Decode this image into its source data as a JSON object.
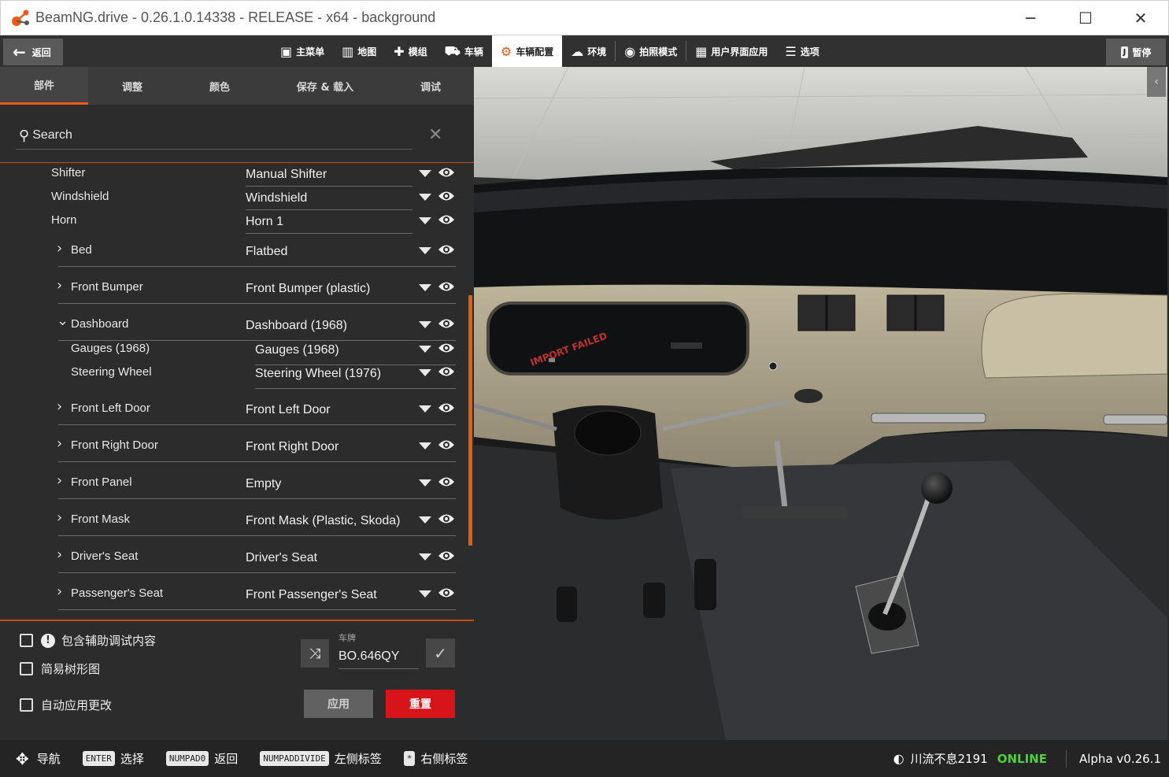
{
  "window": {
    "title": "BeamNG.drive - 0.26.1.0.14338 - RELEASE - x64 - background",
    "minimize": "─",
    "maximize": "☐",
    "close": "✕"
  },
  "menubar": {
    "back_label": "返回",
    "items": [
      {
        "label": "主菜单",
        "icon": "grid-icon"
      },
      {
        "label": "地图",
        "icon": "map-icon"
      },
      {
        "label": "模组",
        "icon": "puzzle-icon"
      },
      {
        "label": "车辆",
        "icon": "car-icon"
      },
      {
        "label": "车辆配置",
        "icon": "engine-icon",
        "active": true
      },
      {
        "label": "环境",
        "icon": "weather-icon"
      },
      {
        "label": "拍照模式",
        "icon": "camera-icon"
      },
      {
        "label": "用户界面应用",
        "icon": "apps-icon"
      },
      {
        "label": "选项",
        "icon": "sliders-icon"
      }
    ],
    "pause_label": "暂停",
    "pause_key": "J"
  },
  "tabs": [
    "部件",
    "调整",
    "颜色",
    "保存 & 载入",
    "调试"
  ],
  "search": {
    "placeholder": "Search"
  },
  "parts": [
    {
      "name": "Shifter",
      "value": "Manual Shifter",
      "indent": 0,
      "expandable": false
    },
    {
      "name": "Windshield",
      "value": "Windshield",
      "indent": 0,
      "expandable": false
    },
    {
      "name": "Horn",
      "value": "Horn 1",
      "indent": 0,
      "expandable": false
    },
    {
      "name": "Bed",
      "value": "Flatbed",
      "indent": 1,
      "expandable": true
    },
    {
      "name": "Front Bumper",
      "value": "Front Bumper (plastic)",
      "indent": 1,
      "expandable": true
    },
    {
      "name": "Dashboard",
      "value": "Dashboard (1968)",
      "indent": 1,
      "expandable": true,
      "expanded": true
    },
    {
      "name": "Gauges (1968)",
      "value": "Gauges (1968)",
      "indent": 2,
      "expandable": false
    },
    {
      "name": "Steering Wheel",
      "value": "Steering Wheel (1976)",
      "indent": 2,
      "expandable": false
    },
    {
      "name": "Front Left Door",
      "value": "Front Left Door",
      "indent": 1,
      "expandable": true
    },
    {
      "name": "Front Right Door",
      "value": "Front Right Door",
      "indent": 1,
      "expandable": true
    },
    {
      "name": "Front Panel",
      "value": "Empty",
      "indent": 1,
      "expandable": true
    },
    {
      "name": "Front Mask",
      "value": "Front Mask (Plastic, Skoda)",
      "indent": 1,
      "expandable": true
    },
    {
      "name": "Driver's Seat",
      "value": "Driver's Seat",
      "indent": 1,
      "expandable": true
    },
    {
      "name": "Passenger's Seat",
      "value": "Front Passenger's Seat",
      "indent": 1,
      "expandable": true
    }
  ],
  "options": {
    "include_aux": "包含辅助调试内容",
    "simple_tree": "简易树形图",
    "auto_apply": "自动应用更改"
  },
  "plate": {
    "label": "车牌",
    "value": "BO.646QY"
  },
  "buttons": {
    "apply": "应用",
    "reset": "重置"
  },
  "viewport": {
    "decal_text": "IMPORT FAILED"
  },
  "bottombar": {
    "hints": [
      {
        "key": "✥",
        "label": "导航"
      },
      {
        "key": "ENTER",
        "label": "选择"
      },
      {
        "key": "NUMPAD0",
        "label": "返回"
      },
      {
        "key": "NUMPADDIVIDE",
        "label": "左侧标签"
      },
      {
        "key": "*",
        "label": "右侧标签"
      }
    ],
    "username": "川流不息2191",
    "online": "ONLINE",
    "version": "Alpha v0.26.1"
  }
}
